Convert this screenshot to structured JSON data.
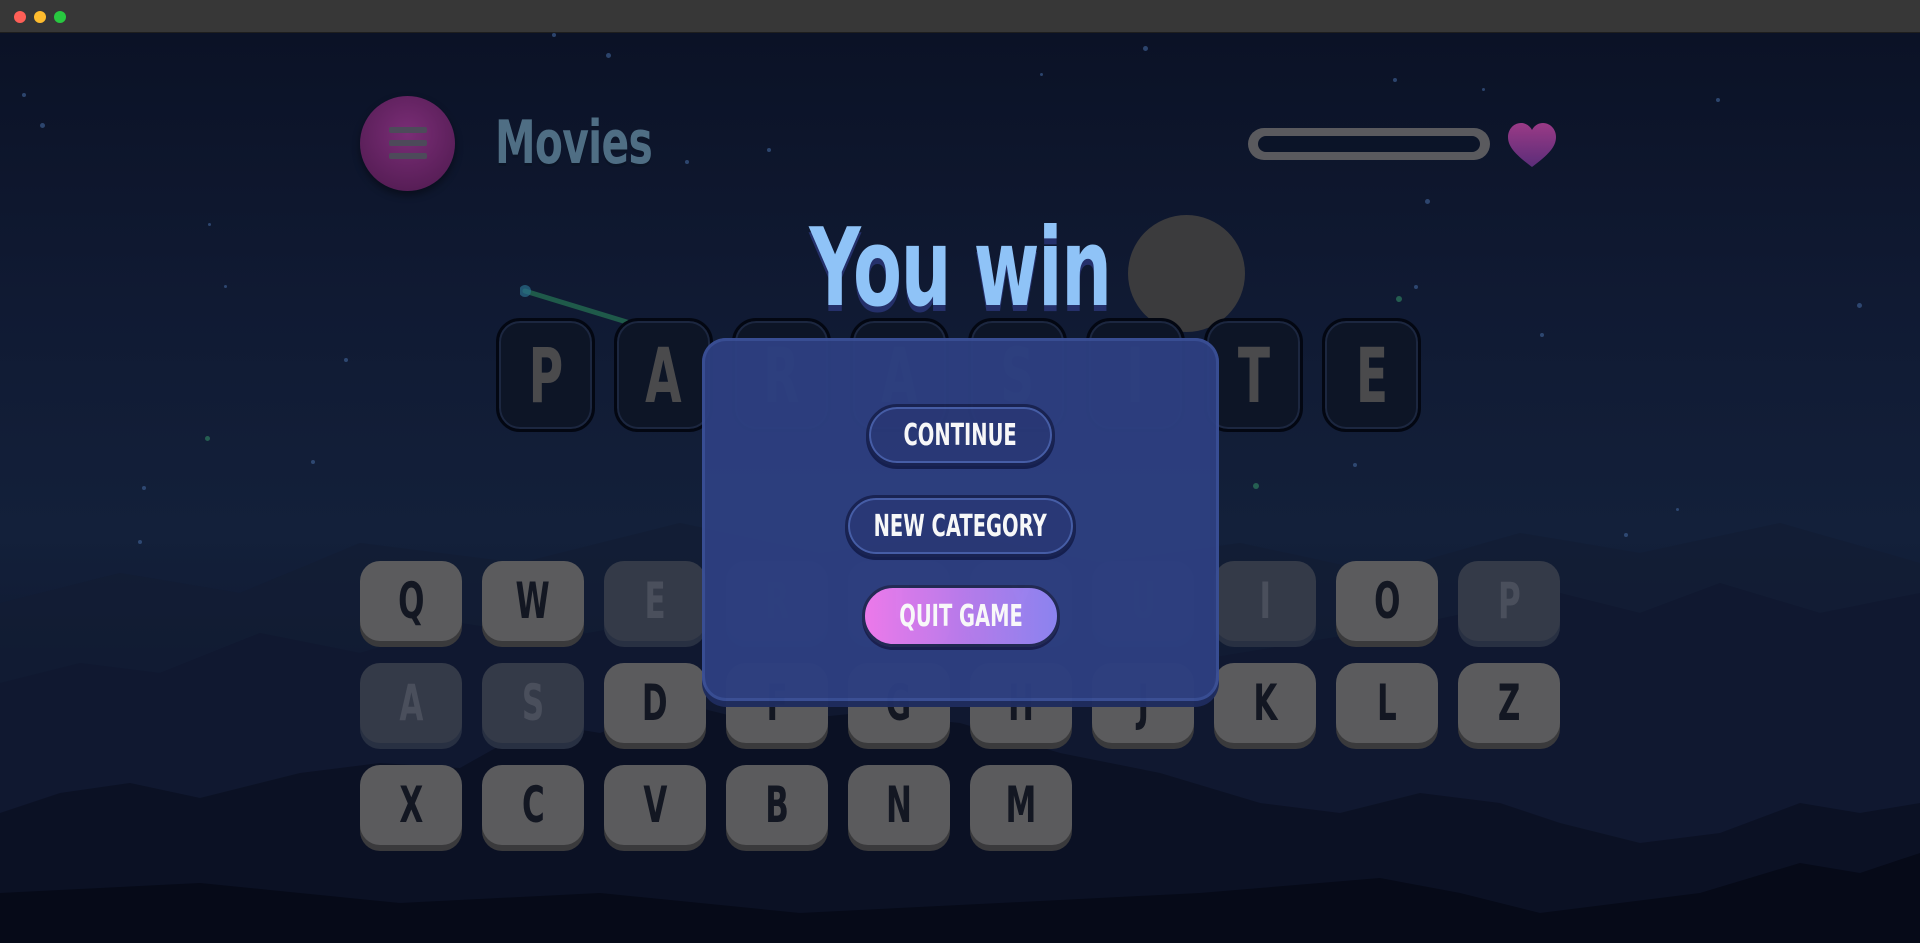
{
  "window": {
    "buttons": [
      "close",
      "minimize",
      "maximize"
    ]
  },
  "header": {
    "category": "Movies",
    "menu_icon": "hamburger-menu-icon",
    "lives_icon": "heart-icon",
    "progress_fraction": 0
  },
  "word": {
    "letters": [
      "P",
      "A",
      "R",
      "A",
      "S",
      "I",
      "T",
      "E"
    ]
  },
  "keyboard": {
    "rows": [
      [
        "Q",
        "W",
        "E",
        "R",
        "T",
        "Y",
        "U",
        "I",
        "O",
        "P"
      ],
      [
        "A",
        "S",
        "D",
        "F",
        "G",
        "H",
        "J",
        "K",
        "L",
        "Z"
      ],
      [
        "X",
        "C",
        "V",
        "B",
        "N",
        "M"
      ]
    ],
    "used": [
      "E",
      "R",
      "T",
      "Y",
      "U",
      "I",
      "P",
      "A",
      "S"
    ]
  },
  "modal": {
    "title": "You win",
    "continue_label": "CONTINUE",
    "new_category_label": "NEW CATEGORY",
    "quit_label": "QUIT GAME"
  },
  "colors": {
    "modal_bg": "#2d3f80",
    "title": "#8fc3f7",
    "quit_gradient_start": "#f27cf0",
    "quit_gradient_end": "#8e86f5",
    "menu_button": "#6a2667"
  }
}
